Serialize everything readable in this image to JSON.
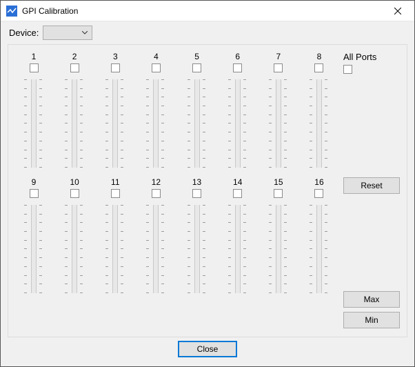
{
  "window": {
    "title": "GPI Calibration"
  },
  "device": {
    "label": "Device:",
    "selected": ""
  },
  "ports": {
    "row1": [
      "1",
      "2",
      "3",
      "4",
      "5",
      "6",
      "7",
      "8"
    ],
    "row2": [
      "9",
      "10",
      "11",
      "12",
      "13",
      "14",
      "15",
      "16"
    ]
  },
  "allports": {
    "label": "All Ports"
  },
  "buttons": {
    "reset": "Reset",
    "max": "Max",
    "min": "Min",
    "close": "Close"
  }
}
